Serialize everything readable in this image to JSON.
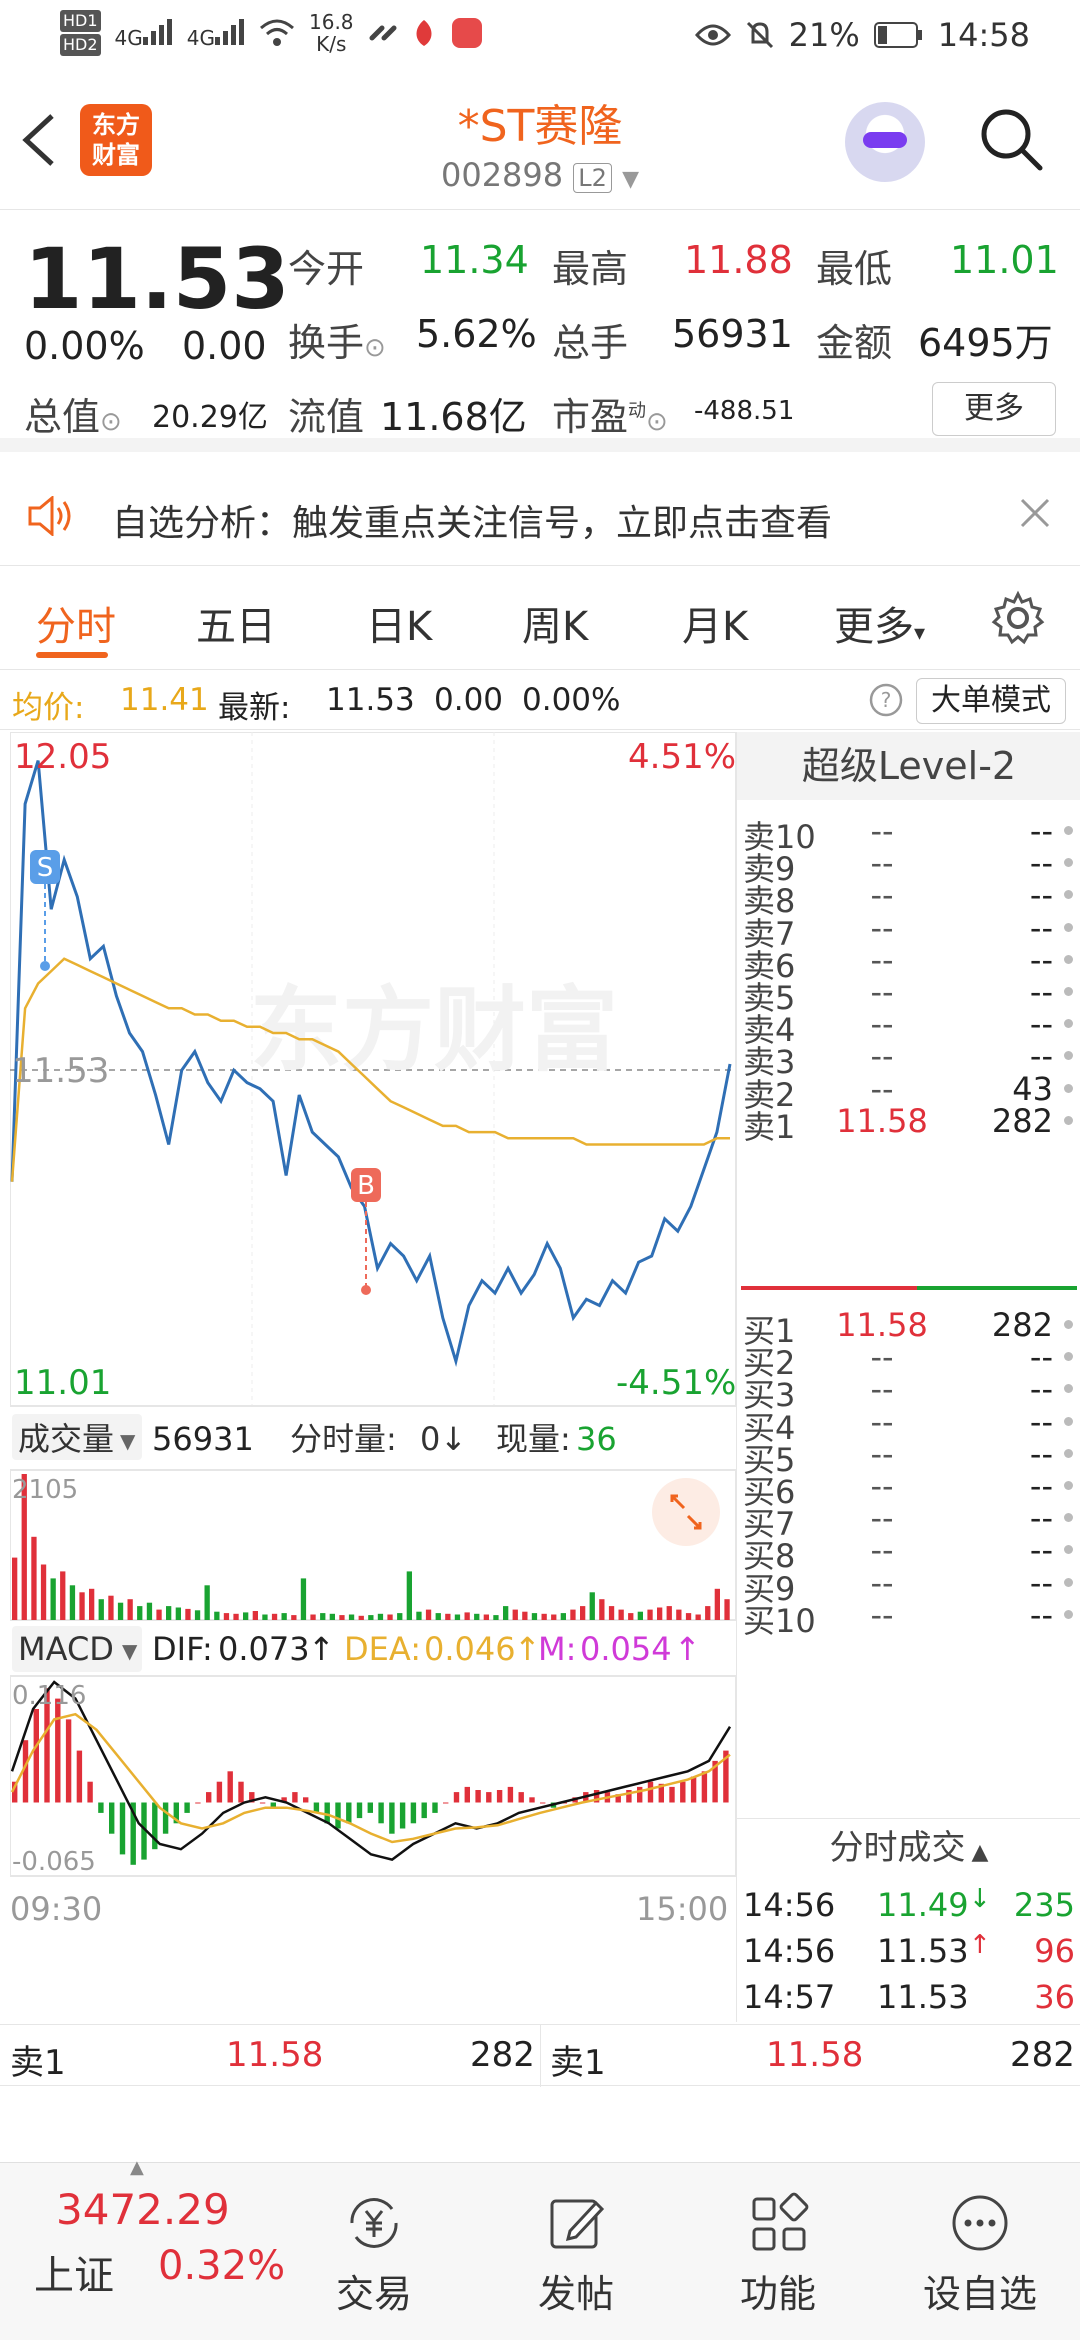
{
  "status_bar": {
    "hd1": "HD1",
    "hd2": "HD2",
    "net1": "4G",
    "net2": "4G",
    "speed_value": "16.8",
    "speed_unit": "K/s",
    "battery": "21%",
    "time": "14:58"
  },
  "header": {
    "logo_line1": "东方",
    "logo_line2": "财富",
    "stock_name": "*ST赛隆",
    "stock_code": "002898",
    "level_tag": "L2"
  },
  "quote": {
    "price": "11.53",
    "change_pct": "0.00%",
    "change_abs": "0.00",
    "open_label": "今开",
    "open_value": "11.34",
    "high_label": "最高",
    "high_value": "11.88",
    "low_label": "最低",
    "low_value": "11.01",
    "turnover_label": "换手",
    "turnover_value": "5.62%",
    "total_hands_label": "总手",
    "total_hands_value": "56931",
    "amount_label": "金额",
    "amount_value": "6495万",
    "mktcap_label": "总值",
    "mktcap_value": "20.29亿",
    "float_label": "流值",
    "float_value": "11.68亿",
    "pe_label": "市盈",
    "pe_sup": "动",
    "pe_value": "-488.51",
    "more_button": "更多"
  },
  "notice": {
    "text": "自选分析：触发重点关注信号，立即点击查看"
  },
  "tabs": [
    {
      "label": "分时",
      "active": true
    },
    {
      "label": "五日",
      "active": false
    },
    {
      "label": "日K",
      "active": false
    },
    {
      "label": "周K",
      "active": false
    },
    {
      "label": "月K",
      "active": false
    },
    {
      "label": "更多",
      "active": false
    }
  ],
  "info_line": {
    "avg_label": "均价:",
    "avg_value": "11.41",
    "latest_label": "最新:",
    "latest_value": "11.53",
    "latest_change": "0.00",
    "latest_pct": "0.00%",
    "big_order_button": "大单模式"
  },
  "chart_labels": {
    "price_high": "12.05",
    "price_low": "11.01",
    "price_mid": "11.53",
    "pct_high": "4.51%",
    "pct_low": "-4.51%",
    "marker_s": "S",
    "marker_b": "B",
    "watermark": "东方财富",
    "volume_select": "成交量",
    "volume_value": "56931",
    "tick_vol_label": "分时量:",
    "tick_vol_value": "0",
    "current_vol_label": "现量:",
    "current_vol_value": "36",
    "vol_axis_max": "2105",
    "macd_select": "MACD",
    "dif_label": "DIF:",
    "dif_value": "0.073",
    "dea_label": "DEA:",
    "dea_value": "0.046",
    "m_label": "M:",
    "m_value": "0.054",
    "macd_top": "0.116",
    "macd_bottom": "-0.065",
    "time_start": "09:30",
    "time_end": "15:00"
  },
  "level2": {
    "title": "超级Level-2",
    "asks": [
      {
        "label": "卖10",
        "price": "--",
        "vol": "--"
      },
      {
        "label": "卖9",
        "price": "--",
        "vol": "--"
      },
      {
        "label": "卖8",
        "price": "--",
        "vol": "--"
      },
      {
        "label": "卖7",
        "price": "--",
        "vol": "--"
      },
      {
        "label": "卖6",
        "price": "--",
        "vol": "--"
      },
      {
        "label": "卖5",
        "price": "--",
        "vol": "--"
      },
      {
        "label": "卖4",
        "price": "--",
        "vol": "--"
      },
      {
        "label": "卖3",
        "price": "--",
        "vol": "--"
      },
      {
        "label": "卖2",
        "price": "--",
        "vol": "43"
      },
      {
        "label": "卖1",
        "price": "11.58",
        "vol": "282"
      }
    ],
    "bids": [
      {
        "label": "买1",
        "price": "11.58",
        "vol": "282"
      },
      {
        "label": "买2",
        "price": "--",
        "vol": "--"
      },
      {
        "label": "买3",
        "price": "--",
        "vol": "--"
      },
      {
        "label": "买4",
        "price": "--",
        "vol": "--"
      },
      {
        "label": "买5",
        "price": "--",
        "vol": "--"
      },
      {
        "label": "买6",
        "price": "--",
        "vol": "--"
      },
      {
        "label": "买7",
        "price": "--",
        "vol": "--"
      },
      {
        "label": "买8",
        "price": "--",
        "vol": "--"
      },
      {
        "label": "买9",
        "price": "--",
        "vol": "--"
      },
      {
        "label": "买10",
        "price": "--",
        "vol": "--"
      }
    ],
    "trades_title": "分时成交",
    "trades": [
      {
        "time": "14:56",
        "price": "11.49",
        "dir": "down",
        "vol": "235"
      },
      {
        "time": "14:56",
        "price": "11.53",
        "dir": "up",
        "vol": "96"
      },
      {
        "time": "14:57",
        "price": "11.53",
        "dir": "none",
        "vol": "36"
      }
    ]
  },
  "order_row": {
    "left_label": "卖1",
    "left_price": "11.58",
    "left_vol": "282",
    "right_label": "卖1",
    "right_price": "11.58",
    "right_vol": "282"
  },
  "bottom_nav": {
    "index_value": "3472.29",
    "index_name": "上证",
    "index_pct": "0.32%",
    "items": [
      {
        "label": "交易",
        "icon": "yuan-cycle-icon"
      },
      {
        "label": "发帖",
        "icon": "edit-icon"
      },
      {
        "label": "功能",
        "icon": "grid-icon"
      },
      {
        "label": "设自选",
        "icon": "more-dots-icon"
      }
    ]
  },
  "colors": {
    "accent": "#f0641e",
    "up": "#e0303a",
    "down": "#19a331",
    "price_line": "#2f6fb5",
    "avg_line": "#e8b030",
    "grid": "#e6e6e6"
  },
  "chart_data": [
    {
      "type": "line",
      "title": "",
      "xlabel": "",
      "ylabel": "",
      "x_range": [
        "09:30",
        "15:00"
      ],
      "ylim": [
        11.01,
        12.05
      ],
      "series": [
        {
          "values": [
            11.34,
            11.95,
            12.02,
            11.78,
            11.86,
            11.8,
            11.7,
            11.72,
            11.64,
            11.58,
            11.55,
            11.48,
            11.4,
            11.52,
            11.55,
            11.5,
            11.47,
            11.52,
            11.5,
            11.49,
            11.47,
            11.35,
            11.48,
            11.42,
            11.4,
            11.38,
            11.33,
            11.3,
            11.2,
            11.24,
            11.22,
            11.18,
            11.22,
            11.12,
            11.05,
            11.14,
            11.18,
            11.16,
            11.2,
            11.16,
            11.19,
            11.24,
            11.2,
            11.12,
            11.15,
            11.14,
            11.18,
            11.16,
            11.21,
            11.22,
            11.28,
            11.26,
            11.3,
            11.36,
            11.42,
            11.53
          ]
        },
        {
          "values": [
            11.34,
            11.62,
            11.66,
            11.68,
            11.7,
            11.69,
            11.68,
            11.67,
            11.66,
            11.65,
            11.64,
            11.63,
            11.62,
            11.62,
            11.61,
            11.61,
            11.6,
            11.6,
            11.59,
            11.59,
            11.58,
            11.58,
            11.57,
            11.57,
            11.56,
            11.55,
            11.53,
            11.51,
            11.49,
            11.47,
            11.46,
            11.45,
            11.44,
            11.43,
            11.43,
            11.42,
            11.42,
            11.42,
            11.41,
            11.41,
            11.41,
            11.41,
            11.41,
            11.41,
            11.4,
            11.4,
            11.4,
            11.4,
            11.4,
            11.4,
            11.4,
            11.4,
            11.4,
            11.4,
            11.41,
            11.41
          ]
        }
      ],
      "reference": 11.53
    },
    {
      "type": "bar",
      "title": "",
      "ylim": [
        0,
        2105
      ],
      "values": [
        900,
        2105,
        1200,
        800,
        600,
        700,
        500,
        400,
        450,
        300,
        350,
        250,
        300,
        200,
        250,
        150,
        200,
        180,
        160,
        140,
        500,
        120,
        100,
        90,
        110,
        130,
        80,
        90,
        100,
        70,
        600,
        80,
        100,
        90,
        70,
        80,
        60,
        70,
        90,
        80,
        100,
        700,
        120,
        150,
        100,
        90,
        80,
        110,
        90,
        80,
        70,
        200,
        150,
        120,
        100,
        90,
        80,
        100,
        150,
        200,
        400,
        300,
        200,
        150,
        100,
        120,
        150,
        180,
        200,
        150,
        100,
        80,
        200,
        450,
        300
      ],
      "colors_by_sign": [
        1,
        1,
        1,
        1,
        -1,
        1,
        -1,
        1,
        1,
        -1,
        1,
        -1,
        1,
        -1,
        -1,
        1,
        -1,
        -1,
        1,
        -1,
        -1,
        -1,
        1,
        1,
        -1,
        1,
        -1,
        1,
        -1,
        1,
        -1,
        1,
        -1,
        -1,
        1,
        -1,
        1,
        -1,
        -1,
        1,
        -1,
        -1,
        -1,
        1,
        -1,
        1,
        -1,
        1,
        -1,
        1,
        -1,
        -1,
        1,
        1,
        -1,
        1,
        1,
        -1,
        1,
        1,
        -1,
        1,
        1,
        1,
        1,
        -1,
        1,
        1,
        1,
        1,
        1,
        1,
        1,
        1,
        1
      ]
    },
    {
      "type": "bar",
      "title": "",
      "ylim": [
        -0.065,
        0.116
      ],
      "values": [
        0.02,
        0.06,
        0.09,
        0.11,
        0.1,
        0.08,
        0.05,
        0.02,
        -0.01,
        -0.03,
        -0.05,
        -0.06,
        -0.055,
        -0.045,
        -0.03,
        -0.02,
        -0.01,
        0.0,
        0.01,
        0.02,
        0.03,
        0.02,
        0.01,
        0.0,
        -0.005,
        0.005,
        0.01,
        0.005,
        -0.01,
        -0.02,
        -0.025,
        -0.02,
        -0.015,
        -0.01,
        -0.02,
        -0.03,
        -0.025,
        -0.02,
        -0.015,
        -0.01,
        0.0,
        0.01,
        0.015,
        0.012,
        0.01,
        0.012,
        0.015,
        0.01,
        0.005,
        0.0,
        -0.005,
        0.0,
        0.005,
        0.01,
        0.012,
        0.01,
        0.008,
        0.012,
        0.015,
        0.02,
        0.018,
        0.015,
        0.02,
        0.025,
        0.03,
        0.04,
        0.05
      ],
      "dif": [
        0.03,
        0.09,
        0.116,
        0.1,
        0.06,
        0.02,
        -0.02,
        -0.04,
        -0.045,
        -0.03,
        -0.01,
        0.0,
        0.005,
        0.0,
        -0.01,
        -0.02,
        -0.035,
        -0.05,
        -0.055,
        -0.04,
        -0.03,
        -0.02,
        -0.025,
        -0.02,
        -0.01,
        -0.005,
        0.0,
        0.005,
        0.01,
        0.015,
        0.02,
        0.025,
        0.03,
        0.04,
        0.073
      ],
      "dea": [
        0.01,
        0.05,
        0.08,
        0.085,
        0.07,
        0.045,
        0.02,
        -0.005,
        -0.02,
        -0.025,
        -0.02,
        -0.01,
        -0.005,
        -0.005,
        -0.008,
        -0.012,
        -0.02,
        -0.03,
        -0.038,
        -0.035,
        -0.03,
        -0.025,
        -0.024,
        -0.022,
        -0.016,
        -0.01,
        -0.005,
        0.0,
        0.004,
        0.008,
        0.012,
        0.017,
        0.022,
        0.03,
        0.046
      ]
    }
  ]
}
